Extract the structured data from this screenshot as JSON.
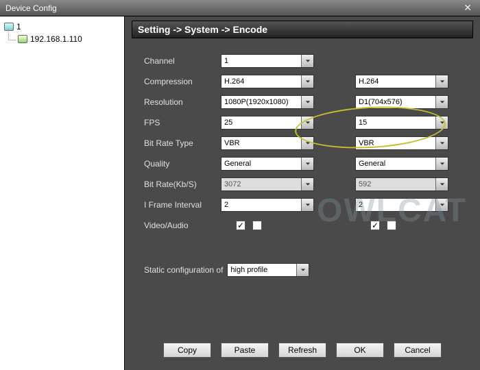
{
  "window": {
    "title": "Device Config"
  },
  "sidebar": {
    "root_label": "1",
    "child_label": "192.168.1.110"
  },
  "breadcrumb": "Setting -> System -> Encode",
  "labels": {
    "channel": "Channel",
    "compression": "Compression",
    "resolution": "Resolution",
    "fps": "FPS",
    "bitratetype": "Bit Rate Type",
    "quality": "Quality",
    "bitrate": "Bit Rate(Kb/S)",
    "iframe": "I Frame Interval",
    "videoaudio": "Video/Audio",
    "static_conf": "Static configuration of"
  },
  "values": {
    "channel": "1",
    "compression1": "H.264",
    "compression2": "H.264",
    "resolution1": "1080P(1920x1080)",
    "resolution2": "D1(704x576)",
    "fps1": "25",
    "fps2": "15",
    "brtype1": "VBR",
    "brtype2": "VBR",
    "quality1": "General",
    "quality2": "General",
    "bitrate1": "3072",
    "bitrate2": "592",
    "iframe1": "2",
    "iframe2": "2",
    "static_profile": "high profile"
  },
  "checkboxes": {
    "video1": true,
    "audio1": false,
    "video2": true,
    "audio2": false
  },
  "buttons": {
    "copy": "Copy",
    "paste": "Paste",
    "refresh": "Refresh",
    "ok": "OK",
    "cancel": "Cancel"
  },
  "watermark": "OWLCAT"
}
